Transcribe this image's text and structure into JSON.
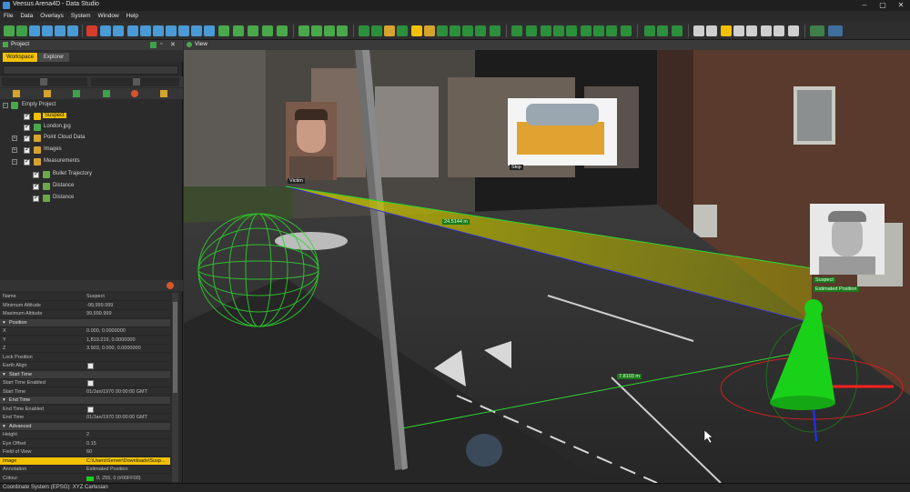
{
  "window": {
    "title": "Veesus Arena4D - Data Studio"
  },
  "menu": [
    "File",
    "Data",
    "Overlays",
    "System",
    "Window",
    "Help"
  ],
  "project_panel": {
    "title": "Project",
    "tabs": [
      "Workspace",
      "Explorer"
    ],
    "tree": [
      {
        "label": "Empty Project",
        "level": 0
      },
      {
        "label": "Suspect",
        "level": 1,
        "selected": true
      },
      {
        "label": "London.jpg",
        "level": 1
      },
      {
        "label": "Point Cloud Data",
        "level": 1
      },
      {
        "label": "Images",
        "level": 1
      },
      {
        "label": "Measurements",
        "level": 1
      },
      {
        "label": "Bullet Trajectory",
        "level": 2
      },
      {
        "label": "Distance",
        "level": 2
      },
      {
        "label": "Distance",
        "level": 2
      }
    ]
  },
  "properties": {
    "rows": [
      {
        "type": "row",
        "k": "Name",
        "v": "Suspect"
      },
      {
        "type": "row",
        "k": "Minimum Altitude",
        "v": "-99,999.999"
      },
      {
        "type": "row",
        "k": "Maximum Altitude",
        "v": "99,999.999"
      },
      {
        "type": "sec",
        "k": "Position"
      },
      {
        "type": "row",
        "k": "X",
        "v": "0.000, 0.0000000"
      },
      {
        "type": "row",
        "k": "Y",
        "v": "1,819.219, 0.0000000"
      },
      {
        "type": "row",
        "k": "Z",
        "v": "3.903, 0.000, 0.0000000"
      },
      {
        "type": "row",
        "k": "Lock Position",
        "v": ""
      },
      {
        "type": "chk",
        "k": "Earth Align"
      },
      {
        "type": "sec",
        "k": "Start Time"
      },
      {
        "type": "chk",
        "k": "Start Time Enabled"
      },
      {
        "type": "row",
        "k": "Start Time",
        "v": "01/Jan/1970 00:00:00 GMT"
      },
      {
        "type": "sec",
        "k": "End Time"
      },
      {
        "type": "chk",
        "k": "End Time Enabled"
      },
      {
        "type": "row",
        "k": "End Time",
        "v": "01/Jan/1970 00:00:00 GMT"
      },
      {
        "type": "sec",
        "k": "Advanced"
      },
      {
        "type": "row",
        "k": "Height",
        "v": "2"
      },
      {
        "type": "row",
        "k": "Eye Offset",
        "v": "0.15"
      },
      {
        "type": "row",
        "k": "Field of View",
        "v": "60"
      },
      {
        "type": "sel",
        "k": "Image",
        "v": "C:\\Users\\Server\\Downloads\\Susp..."
      },
      {
        "type": "row",
        "k": "Annotation",
        "v": "Estimated Position"
      },
      {
        "type": "row",
        "k": "Colour",
        "v": "0, 255, 0 (#00FF00)"
      }
    ]
  },
  "view": {
    "title": "View",
    "labels": {
      "victim": "Victim",
      "skip": "Skip",
      "suspect": "Suspect",
      "estimated": "Estimated Position",
      "dist1": "24.5144 m",
      "dist2": "7.8103 m"
    }
  },
  "status": {
    "text": "Coordinate System (EPSG): XYZ Cartesian"
  },
  "colors": {
    "accent": "#f2c200",
    "green": "#19d119",
    "yellow_cone": "#d4d100"
  }
}
